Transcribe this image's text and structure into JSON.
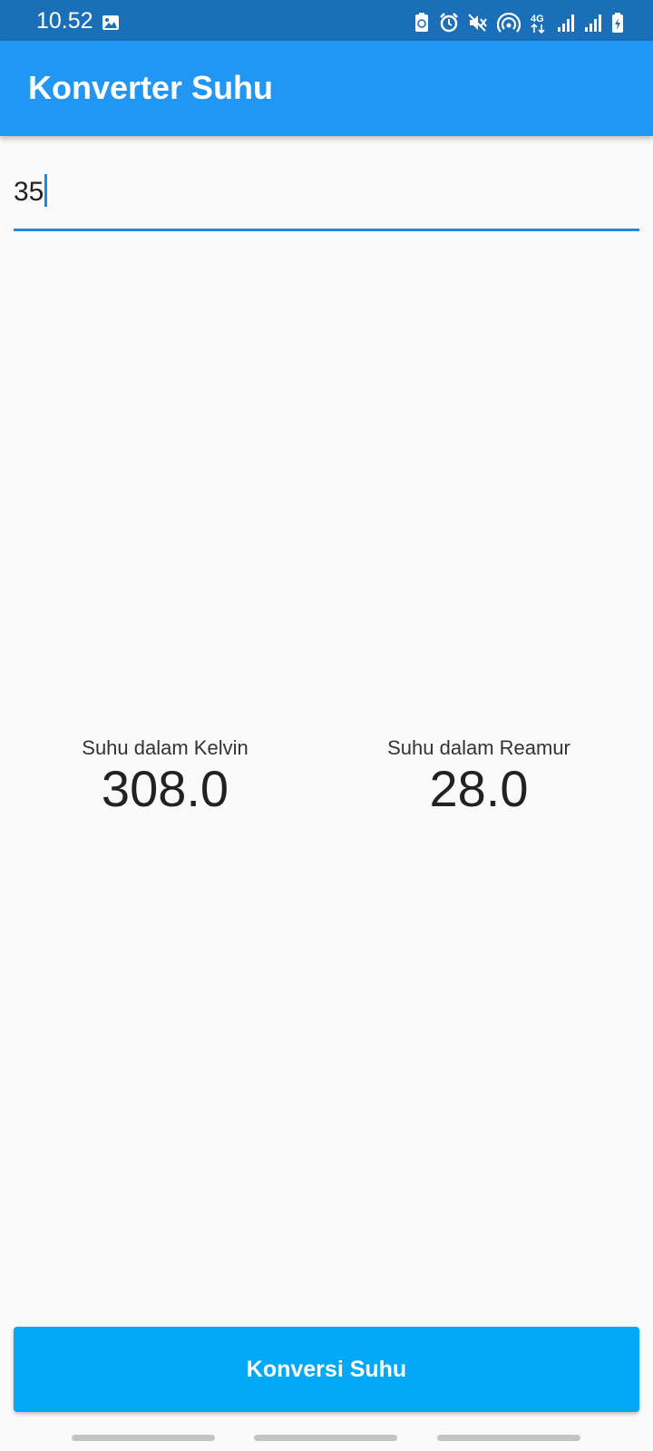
{
  "status_bar": {
    "time": "10.52",
    "icons": [
      "gallery-icon",
      "recycle-icon",
      "alarm-icon",
      "mute-icon",
      "hotspot-icon",
      "4g-icon",
      "signal-icon",
      "signal-icon",
      "battery-charging-icon"
    ],
    "network_label": "4G"
  },
  "app_bar": {
    "title": "Konverter Suhu",
    "color": "#2196f3"
  },
  "input": {
    "value": "35",
    "accent_color": "#1e88e5"
  },
  "results": {
    "kelvin": {
      "label": "Suhu dalam Kelvin",
      "value": "308.0"
    },
    "reamur": {
      "label": "Suhu dalam Reamur",
      "value": "28.0"
    }
  },
  "convert_button": {
    "label": "Konversi Suhu",
    "color": "#03a9f4"
  }
}
